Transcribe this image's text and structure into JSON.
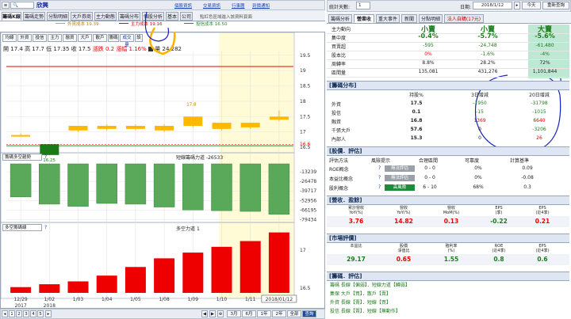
{
  "colors": {
    "up": "#e00000",
    "down": "#2f8a2f",
    "highlight": "#fffbd7",
    "blueInk": "#1520c0",
    "orangeInk": "#ffb000"
  },
  "toolbar": {
    "stock_name": "欣興",
    "tabs": [
      "籌碼K線",
      "籌碼走勢",
      "分點明細",
      "大戶券商",
      "主力動態",
      "籌碼分布",
      "個股分析",
      "基本",
      "公司"
    ],
    "links": [
      "個股資訊",
      "交易資訊",
      "行事曆",
      "到價通知"
    ],
    "subtitle": "點紅色區域進入該資料頁面"
  },
  "chart_toolbar": {
    "buttons": [
      "均線",
      "外資",
      "投信",
      "主力",
      "融資",
      "大戶",
      "散戶",
      "籌碼",
      "成交量"
    ],
    "extra_btn": "設"
  },
  "ma_legend": {
    "foreign": "外資成本 19.39",
    "main": "主力成本 19.16",
    "trust": "投信成本 16.50"
  },
  "price_header": {
    "open_label": "開",
    "open": "17.4",
    "high_label": "高",
    "high": "17.7",
    "low_label": "低",
    "low": "17.35",
    "close_label": "收",
    "close": "17.5",
    "chg_label": "漲跌",
    "chg": "0.2",
    "pct_label": "漲幅",
    "pct": "1.16%",
    "vol_label": "量",
    "vol": "24,282"
  },
  "price_axis": [
    "19.5",
    "19",
    "18.5",
    "18",
    "17.5",
    "17",
    "16.6",
    "16.5"
  ],
  "price_labels": {
    "hi": "17.8",
    "lo": "16.25"
  },
  "indicator1": {
    "select": "籌碼多空趨勢",
    "title": "短線籌碼力道",
    "value": "-26533",
    "axis": [
      "-13239",
      "-26478",
      "-39717",
      "-52956",
      "-66195",
      "-79434"
    ]
  },
  "indicator2": {
    "select": "多空籌碼線",
    "title": "多空力道",
    "value": "1",
    "axis": [
      "17",
      "16.5"
    ]
  },
  "chart_data": [
    {
      "type": "candlestick",
      "title": "",
      "x": [
        "12/29",
        "01/02",
        "01/03",
        "01/04",
        "01/05",
        "01/08",
        "01/09",
        "01/10",
        "01/11",
        "01/12"
      ],
      "ohlc": [
        [
          16.9,
          16.95,
          16.85,
          16.9
        ],
        [
          16.25,
          16.6,
          16.25,
          16.6
        ],
        [
          17.05,
          17.2,
          17.0,
          17.2
        ],
        [
          17.1,
          17.25,
          17.05,
          17.2
        ],
        [
          17.1,
          17.25,
          17.05,
          17.2
        ],
        [
          17.05,
          17.25,
          17.0,
          17.2
        ],
        [
          17.2,
          17.5,
          17.15,
          17.5
        ],
        [
          17.1,
          17.3,
          17.05,
          17.3
        ],
        [
          17.15,
          17.3,
          17.1,
          17.3
        ],
        [
          17.4,
          17.7,
          17.35,
          17.5
        ]
      ],
      "ylim": [
        16.4,
        19.7
      ]
    },
    {
      "type": "bar",
      "title": "短線籌碼力道",
      "categories": [
        "12/29",
        "01/02",
        "01/03",
        "01/04",
        "01/05",
        "01/08",
        "01/09",
        "01/10",
        "01/11",
        "01/12"
      ],
      "values": [
        -48000,
        -58000,
        -61000,
        -57000,
        -58000,
        -62000,
        -66000,
        -67000,
        -68000,
        -72000
      ],
      "ylim": [
        0,
        -80000
      ]
    },
    {
      "type": "bar",
      "title": "多空力道",
      "categories": [
        "12/29",
        "01/02",
        "01/03",
        "01/04",
        "01/05",
        "01/08",
        "01/09",
        "01/10",
        "01/11",
        "01/12"
      ],
      "values": [
        2,
        3,
        4,
        6,
        9,
        12,
        14,
        16,
        18,
        21
      ],
      "ylim": [
        0,
        22
      ]
    }
  ],
  "x_labels": [
    "12/29",
    "1/02",
    "1/03",
    "1/04",
    "1/05",
    "1/08",
    "1/09",
    "1/10",
    "1/11",
    "2018/01/12"
  ],
  "x_years": [
    "2017",
    "2018"
  ],
  "bottom_nav": {
    "pages": [
      "1",
      "2",
      "3",
      "4",
      "5"
    ],
    "ranges": [
      "3月",
      "6月",
      "1年",
      "2年",
      "全部",
      "查詢"
    ]
  },
  "right": {
    "toolbar": {
      "label": "統計天數:",
      "days": "1",
      "date_label": "日期:",
      "date": "2018/1/12",
      "today": "今天",
      "reset": "重新查詢"
    },
    "tabs": [
      "籌碼分析",
      "營業收",
      "重大事件",
      "新聞",
      "分點明細",
      "法人自購(17元)"
    ],
    "summary": {
      "headers": [
        "",
        "1日",
        "5日",
        "20日"
      ],
      "rows": [
        {
          "label": "主力動向",
          "vals": [
            "小賣",
            "小賣",
            "大賣"
          ]
        },
        {
          "label": "集中度",
          "vals": [
            "-0.4%",
            "-5.7%",
            "-5.6%"
          ]
        },
        {
          "label": "買賣超",
          "vals": [
            "-595",
            "-24,748",
            "-61,480"
          ]
        },
        {
          "label": "股本比",
          "vals": [
            "0%",
            "-1.6%",
            "-4%"
          ]
        },
        {
          "label": "周轉率",
          "vals": [
            "8.8%",
            "28.2%",
            "72%"
          ]
        },
        {
          "label": "區間量",
          "vals": [
            "135,081",
            "431,276",
            "1,101,844"
          ]
        }
      ]
    },
    "dist": {
      "title": "[籌碼分布]",
      "headers": [
        "",
        "持股%",
        "3日增減",
        "20日增減"
      ],
      "rows": [
        {
          "label": "外資",
          "vals": [
            "17.5",
            "-1950",
            "-31798"
          ]
        },
        {
          "label": "投信",
          "vals": [
            "0.1",
            "-15",
            "-1015"
          ]
        },
        {
          "label": "融資",
          "vals": [
            "16.8",
            "1369",
            "6640"
          ]
        },
        {
          "label": "千張大戶",
          "vals": [
            "57.6",
            "0",
            "-3206"
          ]
        },
        {
          "label": "內部人",
          "vals": [
            "15.3",
            "0",
            "26"
          ]
        }
      ]
    },
    "eval": {
      "title": "[股價．評估]",
      "headers": [
        "評估方法",
        "風險提示",
        "合理區間",
        "可靠度",
        "計算基準"
      ],
      "rows": [
        {
          "label": "ROE概念",
          "risk": "無法評估",
          "range": "0 - 0",
          "rel": "0%",
          "base": "0.09"
        },
        {
          "label": "本益比概念",
          "risk": "無法評估",
          "range": "0 - 0",
          "rel": "0%",
          "base": "-0.08"
        },
        {
          "label": "股利概念",
          "risk": "高風險",
          "range": "6 - 10",
          "rel": "68%",
          "base": "0.3"
        }
      ]
    },
    "revenue": {
      "title": "[營收．盈餘]",
      "headers": [
        "累計營收\nYoY(%)",
        "營收\nYoY(%)",
        "營收\nMoM(%)",
        "EPS\n(季)",
        "EPS\n(近4季)"
      ],
      "vals": [
        "3.76",
        "14.82",
        "0.13",
        "-0.22",
        "0.21"
      ]
    },
    "market": {
      "title": "[市場評價]",
      "headers": [
        "本益比",
        "股價\n淨值比",
        "殖利率\n(%)",
        "ROE\n(近4季)",
        "EPS\n(近4季)"
      ],
      "vals": [
        "29.17",
        "0.65",
        "1.55",
        "0.8",
        "0.6"
      ]
    },
    "chip_eval": {
      "title": "[籌碼．評估]",
      "lines": [
        "籌碼 長線【偏弱】．短線力道【轉弱】",
        "集保 大戶【買】．散戶【賣】",
        "外資 長線【賣】．短線【買】",
        "投信 長線【賣】．短線【無動作】"
      ]
    }
  }
}
